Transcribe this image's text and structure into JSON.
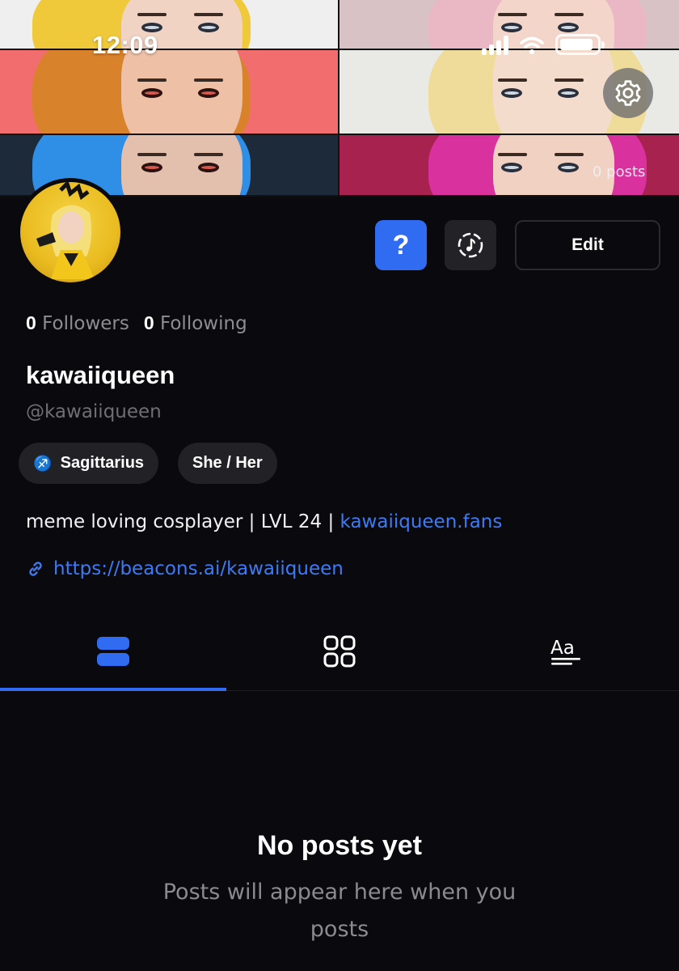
{
  "status_bar": {
    "time": "12:09"
  },
  "header": {
    "post_count": "0 posts",
    "settings_icon": "gear-icon",
    "tiles": [
      {
        "hair": "#f0c93a",
        "skin": "#f1d3c4",
        "bg": "#efefef"
      },
      {
        "hair": "#e9b8c4",
        "skin": "#f3d6c9",
        "bg": "#d8c2c6"
      },
      {
        "hair": "#d9822c",
        "skin": "#eec0a6",
        "bg": "#f26d6d"
      },
      {
        "hair": "#f0dc9a",
        "skin": "#f4dccd",
        "bg": "#e9e9e6"
      },
      {
        "hair": "#2f8fe6",
        "skin": "#e3c0ad",
        "bg": "#1c2a3a"
      },
      {
        "hair": "#d9319d",
        "skin": "#f0d1c2",
        "bg": "#a8224f"
      }
    ]
  },
  "profile": {
    "avatar_icon": "avatar",
    "help_label": "?",
    "edit_label": "Edit",
    "music_icon": "music-disc-icon",
    "followers_count": "0",
    "followers_label": "Followers",
    "following_count": "0",
    "following_label": "Following",
    "display_name": "kawaiiqueen",
    "handle": "@kawaiiqueen",
    "tags": {
      "zodiac_symbol": "♐",
      "zodiac": "Sagittarius",
      "pronouns": "She / Her"
    },
    "bio_text": "meme loving cosplayer | LVL 24 | ",
    "bio_link": "kawaiiqueen.fans",
    "website": "https://beacons.ai/kawaiiqueen"
  },
  "tabs": [
    {
      "icon": "list-view-icon",
      "active": true
    },
    {
      "icon": "grid-view-icon",
      "active": false
    },
    {
      "icon": "text-posts-icon",
      "active": false
    }
  ],
  "empty_state": {
    "title": "No posts yet",
    "description": "Posts will appear here when you posts"
  },
  "colors": {
    "accent": "#2f6cf1",
    "link": "#3d7bf6",
    "background": "#0a0a0e"
  }
}
